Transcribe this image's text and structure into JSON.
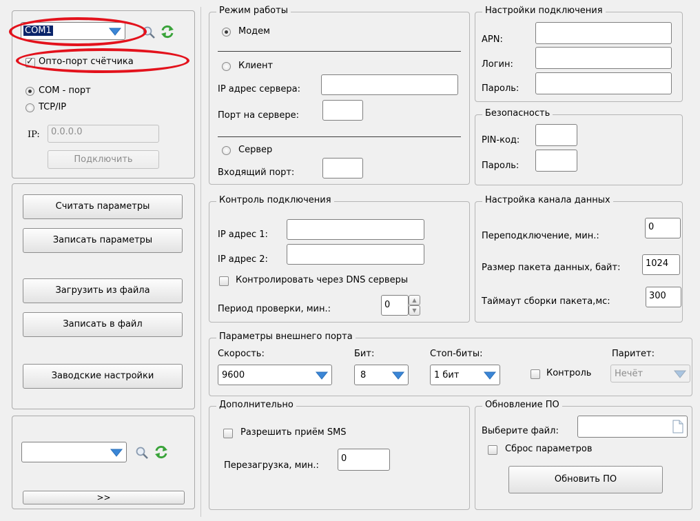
{
  "left": {
    "com_port_value": "COM1",
    "opto_port_label": "Опто-порт счётчика",
    "com_port_radio": "COM - порт",
    "tcpip_radio": "TCP/IP",
    "ip_label": "IP:",
    "ip_value": "0.0.0.0",
    "connect_button": "Подключить",
    "read_params": "Считать параметры",
    "write_params": "Записать параметры",
    "load_from_file": "Загрузить из файла",
    "write_to_file": "Записать в файл",
    "factory_settings": "Заводские настройки",
    "expand_button": ">>"
  },
  "mode": {
    "title": "Режим работы",
    "modem": "Модем",
    "client": "Клиент",
    "server_ip_label": "IP адрес сервера:",
    "server_port_label": "Порт на сервере:",
    "server": "Сервер",
    "incoming_port_label": "Входящий порт:"
  },
  "connection": {
    "title": "Настройки подключения",
    "apn_label": "APN:",
    "login_label": "Логин:",
    "password_label": "Пароль:"
  },
  "security": {
    "title": "Безопасность",
    "pin_label": "PIN-код:",
    "password_label": "Пароль:"
  },
  "control": {
    "title": "Контроль подключения",
    "ip1_label": "IP адрес 1:",
    "ip2_label": "IP адрес 2:",
    "dns_check_label": "Контролировать через DNS серверы",
    "period_label": "Период проверки, мин.:",
    "period_value": "0"
  },
  "channel": {
    "title": "Настройка канала данных",
    "reconnect_label": "Переподключение, мин.:",
    "reconnect_value": "0",
    "packet_size_label": "Размер пакета данных, байт:",
    "packet_size_value": "1024",
    "timeout_label": "Таймаут сборки пакета,мс:",
    "timeout_value": "300"
  },
  "extport": {
    "title": "Параметры внешнего порта",
    "speed_label": "Скорость:",
    "speed_value": "9600",
    "bits_label": "Бит:",
    "bits_value": "8",
    "stopbits_label": "Стоп-биты:",
    "stopbits_value": "1 бит",
    "control_label": "Контроль",
    "parity_label": "Паритет:",
    "parity_value": "Нечёт"
  },
  "extra": {
    "title": "Дополнительно",
    "sms_label": "Разрешить приём SMS",
    "reboot_label": "Перезагрузка, мин.:",
    "reboot_value": "0"
  },
  "update": {
    "title": "Обновление ПО",
    "choose_file_label": "Выберите файл:",
    "reset_params_label": "Сброс параметров",
    "update_button": "Обновить ПО"
  },
  "colors": {
    "highlight_ring": "#e3121c",
    "selection": "#0a246a",
    "dropdown_arrow": "#3b86d6",
    "refresh_icon": "#3aa33a"
  }
}
